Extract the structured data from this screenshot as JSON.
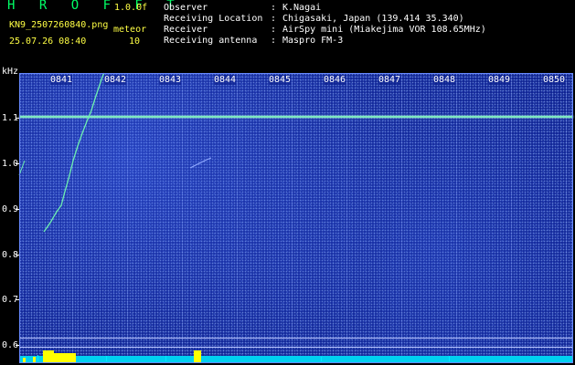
{
  "header": {
    "brand": "H R O F F T",
    "version": "1.0.0f",
    "filename": "KN9_2507260840.png",
    "meteor_label": "meteor",
    "datetime": "25.07.26 08:40",
    "meteor_count": "10",
    "info": [
      {
        "key": "Observer",
        "value": "K.Nagai"
      },
      {
        "key": "Receiving Location",
        "value": "Chigasaki, Japan (139.414 35.340)"
      },
      {
        "key": "Receiver",
        "value": "AirSpy mini (Miakejima VOR 108.65MHz)"
      },
      {
        "key": "Receiving antenna",
        "value": "Maspro FM-3"
      }
    ]
  },
  "spectrogram": {
    "y_unit": "kHz",
    "y_labels": [
      "1.1",
      "1.0",
      "0.9",
      "0.8",
      "0.7",
      "0.6"
    ],
    "x_labels": [
      "0841",
      "0842",
      "0843",
      "0844",
      "0845",
      "0846",
      "0847",
      "0848",
      "0849",
      "0850"
    ],
    "colors": {
      "background": "#0b1d8a",
      "carrier": "#7ee8c0",
      "trace": "#6df0b0",
      "strip": "#00d0f0",
      "power": "#ffff00"
    }
  }
}
